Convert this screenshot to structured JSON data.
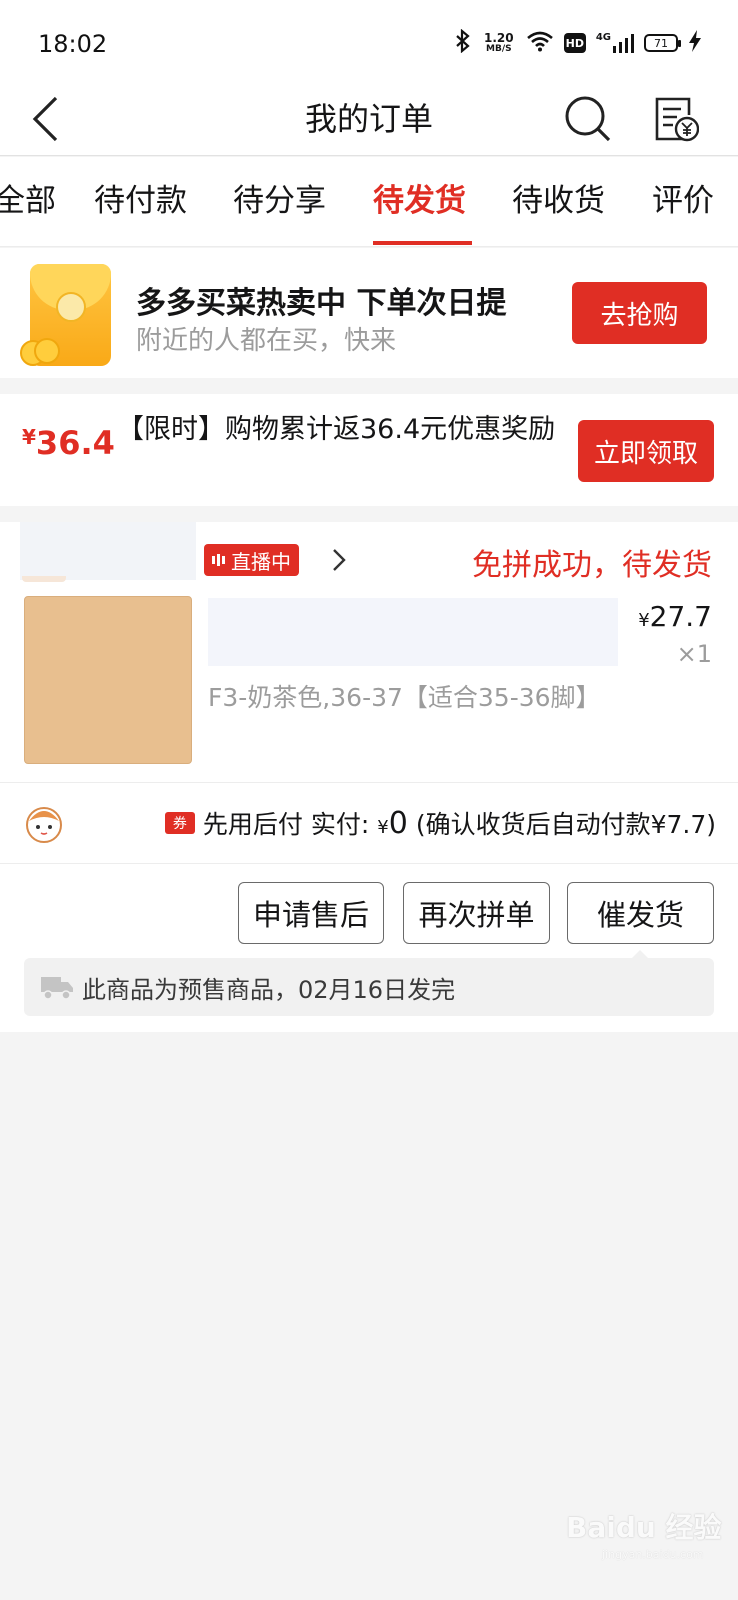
{
  "status_bar": {
    "time": "18:02",
    "net_speed_value": "1.20",
    "net_speed_unit": "MB/S",
    "hd_label": "HD",
    "network_type": "4G",
    "battery_level": "71",
    "icons": [
      "bluetooth-icon",
      "wifi-icon",
      "signal-icon",
      "charging-icon"
    ]
  },
  "nav": {
    "title": "我的订单",
    "icons": [
      "back-arrow-icon",
      "search-icon",
      "bill-icon"
    ]
  },
  "tabs": [
    {
      "label": "全部",
      "active": false
    },
    {
      "label": "待付款",
      "active": false
    },
    {
      "label": "待分享",
      "active": false
    },
    {
      "label": "待发货",
      "active": true
    },
    {
      "label": "待收货",
      "active": false
    },
    {
      "label": "评价",
      "active": false
    }
  ],
  "promo": {
    "title": "多多买菜热卖中 下单次日提",
    "subtitle": "附近的人都在买，快来",
    "button": "去抢购",
    "icon": "red-envelope-icon"
  },
  "coupon": {
    "currency": "¥",
    "amount": "36.4",
    "text": "【限时】购物累计返36.4元优惠奖励",
    "button": "立即领取"
  },
  "order": {
    "live_label": "直播中",
    "status": "免拼成功，待发货",
    "product": {
      "currency": "¥",
      "price": "27.7",
      "quantity": "×1",
      "spec": "F3-奶茶色,36-37【适合35-36脚】"
    },
    "payment": {
      "voucher_tag": "券",
      "label": "先用后付 实付:",
      "currency": "¥",
      "paid": "0",
      "note": "(确认收货后自动付款¥7.7)"
    },
    "actions": [
      "申请售后",
      "再次拼单",
      "催发货"
    ],
    "notice": "此商品为预售商品，02月16日发完"
  },
  "watermark": {
    "brand": "Baidu 经验",
    "url": "jingyan.baidu.com"
  },
  "colors": {
    "accent": "#e02e24",
    "muted_text": "#9c9c9c",
    "background": "#f4f4f4"
  }
}
